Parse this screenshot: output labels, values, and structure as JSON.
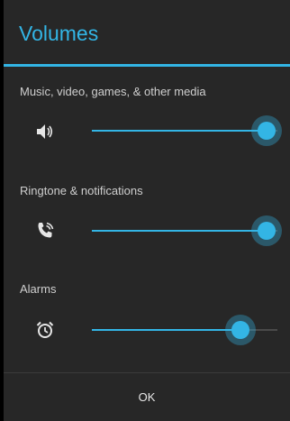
{
  "dialog": {
    "title": "Volumes",
    "accent_color": "#33b5e5",
    "ok_label": "OK"
  },
  "sections": [
    {
      "label": "Music, video, games, & other media",
      "icon": "speaker-icon",
      "level": 0.94
    },
    {
      "label": "Ringtone & notifications",
      "icon": "ringtone-phone-icon",
      "level": 0.94
    },
    {
      "label": "Alarms",
      "icon": "alarm-clock-icon",
      "level": 0.8
    }
  ]
}
